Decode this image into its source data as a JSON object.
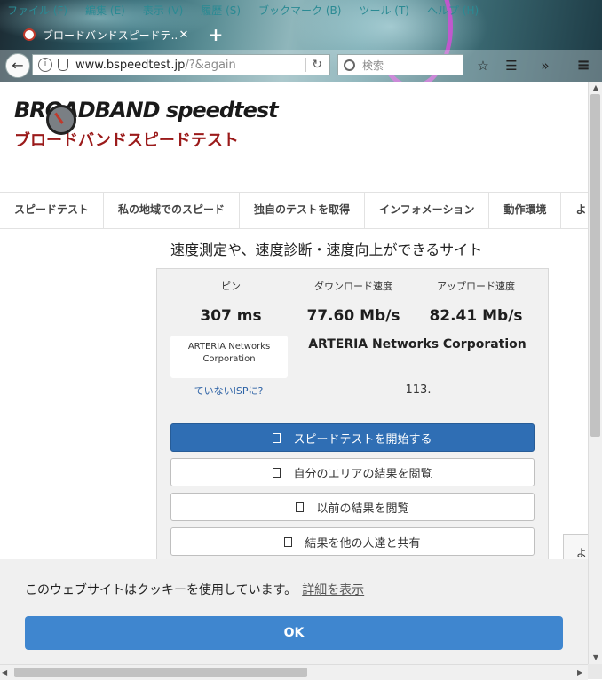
{
  "browser": {
    "menu": [
      "ファイル (F)",
      "編集 (E)",
      "表示 (V)",
      "履歴 (S)",
      "ブックマーク (B)",
      "ツール (T)",
      "ヘルプ (H)"
    ],
    "tab_title": "ブロードバンドスピードテ...",
    "url_host": "www.bspeedtest.jp",
    "url_path": "/?&again",
    "search_placeholder": "検索"
  },
  "logo": {
    "en": "BROADBAND speedtest",
    "jp": "ブロードバンドスピードテスト"
  },
  "nav": [
    "スピードテスト",
    "私の地域でのスピード",
    "独自のテストを取得",
    "インフォメーション",
    "動作環境",
    "よくあ"
  ],
  "tagline": "速度測定や、速度診断・速度向上ができるサイト",
  "results": {
    "ping_label": "ピン",
    "ping_value": "307 ms",
    "download_label": "ダウンロード速度",
    "download_value": "77.60 Mb/s",
    "upload_label": "アップロード速度",
    "upload_value": "82.41 Mb/s",
    "isp_box": "ARTERIA Networks Corporation",
    "isp_name": "ARTERIA Networks Corporation",
    "not_isp_link": "ていないISPに?",
    "number": "113."
  },
  "buttons": {
    "start": "スピードテストを開始する",
    "area": "自分のエリアの結果を閲覧",
    "previous": "以前の結果を閲覧",
    "share": "結果を他の人達と共有"
  },
  "side_tab": "よ",
  "cookie": {
    "message": "このウェブサイトはクッキーを使用しています。",
    "link": "詳細を表示",
    "ok": "OK"
  }
}
